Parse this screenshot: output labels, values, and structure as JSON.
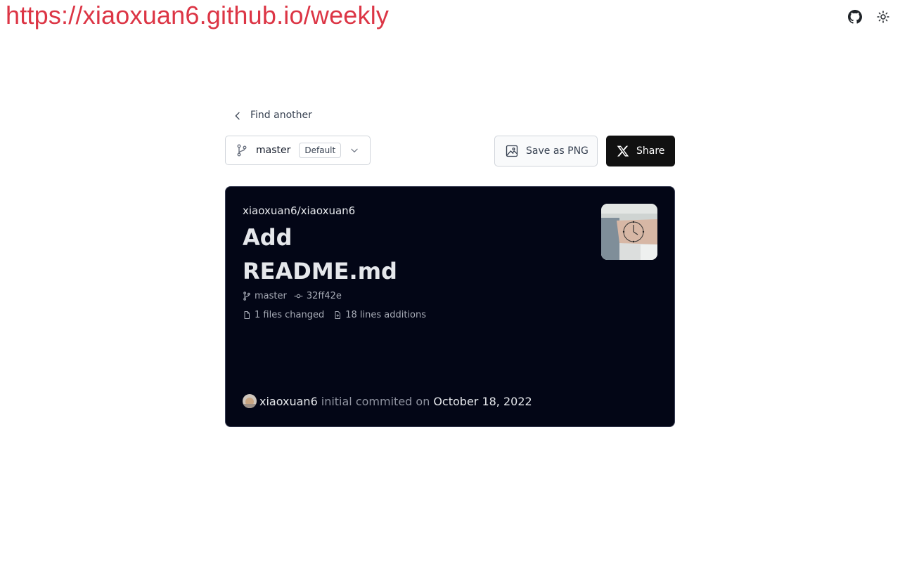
{
  "header": {
    "site_url": "https://xiaoxuan6.github.io/weekly",
    "github_icon": "github-icon",
    "theme_icon": "sun-icon"
  },
  "nav": {
    "back_label": "Find another"
  },
  "branch_selector": {
    "branch": "master",
    "badge": "Default"
  },
  "actions": {
    "save_png_label": "Save as PNG",
    "share_label": "Share"
  },
  "card": {
    "repo": "xiaoxuan6/xiaoxuan6",
    "title": "Add README.md",
    "branch": "master",
    "commit": "32ff42e",
    "files_changed": "1 files changed",
    "lines_added": "18 lines additions",
    "author": "xiaoxuan6",
    "verb": "initial commited on",
    "date": "October 18, 2022"
  },
  "colors": {
    "url_red": "#dc3545",
    "card_bg": "#030616",
    "share_bg": "#111111"
  }
}
